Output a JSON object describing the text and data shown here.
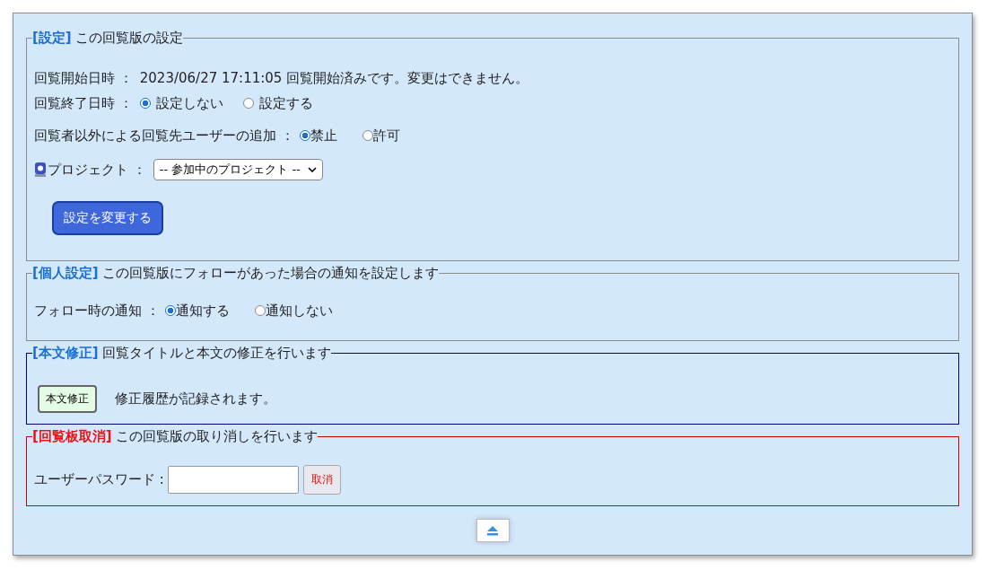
{
  "sections": [
    {
      "kind": "settings",
      "tag": "[設定]",
      "title": "この回覧版の設定",
      "start": {
        "label": "回覧開始日時 ：",
        "value": "2023/06/27 17:11:05 回覧開始済みです。変更はできません。"
      },
      "end": {
        "label": "回覧終了日時 ：",
        "options": [
          {
            "label": "設定しない",
            "selected": true
          },
          {
            "label": "設定する",
            "selected": false
          }
        ]
      },
      "add": {
        "label": "回覧者以外による回覧先ユーザーの追加 ：",
        "options": [
          {
            "label": "禁止",
            "selected": true
          },
          {
            "label": "許可",
            "selected": false
          }
        ]
      },
      "project": {
        "label": "プロジェクト ：",
        "value": "-- 参加中のプロジェクト --"
      },
      "button": "設定を変更する"
    },
    {
      "kind": "notify",
      "tag": "[個人設定]",
      "title": "この回覧版にフォローがあった場合の通知を設定します",
      "notify": {
        "label": "フォロー時の通知 ：",
        "options": [
          {
            "label": "通知する",
            "selected": true
          },
          {
            "label": "通知しない",
            "selected": false
          }
        ]
      }
    },
    {
      "kind": "edit",
      "tag": "[本文修正]",
      "title": "回覧タイトルと本文の修正を行います",
      "button": "本文修正",
      "note": "修正履歴が記録されます。"
    },
    {
      "kind": "cancel",
      "tag": "[回覧板取消]",
      "title": "この回覧版の取り消しを行います",
      "label": "ユーザーパスワード :",
      "button": "取消"
    }
  ]
}
